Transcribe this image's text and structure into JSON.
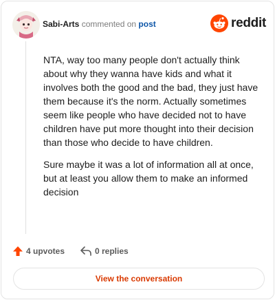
{
  "comment": {
    "author": "Sabi-Arts",
    "action": "commented on",
    "target": "post",
    "paragraphs": [
      "NTA, way too many people don't actually think about why they wanna have kids and what it involves both the good and the bad, they just have them because it's the norm. Actually sometimes seem like people who have decided not to have children have put more thought into their decision than those who decide to have children.",
      "Sure maybe it was a lot of information all at once, but at least you allow them to make an informed decision"
    ]
  },
  "brand": {
    "wordmark": "reddit",
    "accent": "#ff4500"
  },
  "actions": {
    "upvotes": "4 upvotes",
    "replies": "0 replies"
  },
  "cta": {
    "label": "View the conversation"
  },
  "colors": {
    "link": "#0d56a8",
    "cta_text": "#d93900",
    "upvote": "#ff4500"
  }
}
